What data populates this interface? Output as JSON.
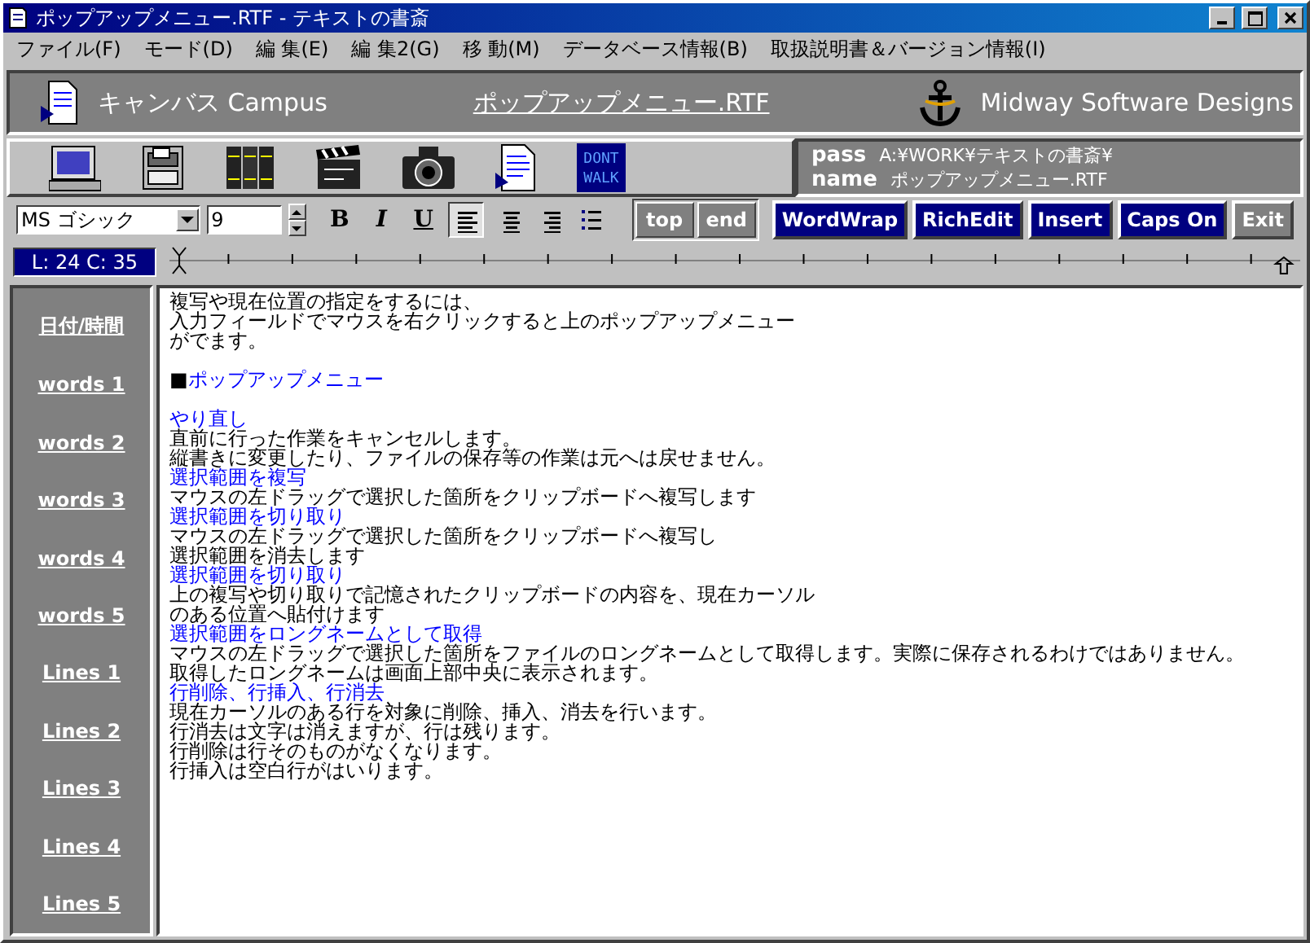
{
  "window": {
    "title": "ポップアップメニュー.RTF - テキストの書斎"
  },
  "menu": [
    "ファイル(F)",
    "モード(D)",
    "編 集(E)",
    "編 集2(G)",
    "移 動(M)",
    "データベース情報(B)",
    "取扱説明書＆バージョン情報(I)"
  ],
  "header": {
    "app_name": "キャンバス Campus",
    "document": "ポップアップメニュー.RTF",
    "company": "Midway Software Designs"
  },
  "toolbar": {
    "tools": [
      {
        "kind": "monitor"
      },
      {
        "kind": "cabinet"
      },
      {
        "kind": "books"
      },
      {
        "kind": "clapper"
      },
      {
        "kind": "camera"
      },
      {
        "kind": "document"
      },
      {
        "kind": "sign",
        "lines": [
          "DONT",
          "WALK"
        ]
      }
    ]
  },
  "info": {
    "pass_label": "pass",
    "pass": "A:¥WORK¥テキストの書斎¥",
    "name_label": "name",
    "name": "ポップアップメニュー.RTF"
  },
  "format": {
    "font": "MS ゴシック",
    "size": "9",
    "styles": [
      "B",
      "I",
      "U"
    ],
    "align": [
      {
        "kind": "left",
        "selected": true
      },
      {
        "kind": "center",
        "selected": false
      },
      {
        "kind": "right",
        "selected": false
      },
      {
        "kind": "bullets",
        "selected": false
      }
    ],
    "nav": [
      "top",
      "end"
    ],
    "actions": [
      {
        "label": "WordWrap",
        "kind": "mode"
      },
      {
        "label": "RichEdit",
        "kind": "mode"
      },
      {
        "label": "Insert",
        "kind": "mode"
      },
      {
        "label": "Caps On",
        "kind": "mode"
      },
      {
        "label": "Exit",
        "kind": "exit"
      }
    ]
  },
  "status": "L: 24 C: 35",
  "sidebar": {
    "items": [
      "日付/時間",
      "words 1",
      "words 2",
      "words 3",
      "words 4",
      "words 5",
      "Lines 1",
      "Lines 2",
      "Lines 3",
      "Lines 4",
      "Lines 5"
    ]
  },
  "editor": {
    "lines": [
      {
        "kind": "text",
        "text": "複写や現在位置の指定をするには、"
      },
      {
        "kind": "text",
        "text": "入力フィールドでマウスを右クリックすると上のポップアップメニュー"
      },
      {
        "kind": "text",
        "text": "がでます。"
      },
      {
        "kind": "blank"
      },
      {
        "kind": "heading",
        "marker": "■",
        "text": "ポップアップメニュー"
      },
      {
        "kind": "blank"
      },
      {
        "kind": "link",
        "text": "やり直し"
      },
      {
        "kind": "text",
        "text": "直前に行った作業をキャンセルします。"
      },
      {
        "kind": "text",
        "text": "縦書きに変更したり、ファイルの保存等の作業は元へは戻せません。"
      },
      {
        "kind": "link",
        "text": "選択範囲を複写"
      },
      {
        "kind": "text",
        "text": "マウスの左ドラッグで選択した箇所をクリップボードへ複写します"
      },
      {
        "kind": "link",
        "text": "選択範囲を切り取り"
      },
      {
        "kind": "text",
        "text": "マウスの左ドラッグで選択した箇所をクリップボードへ複写し"
      },
      {
        "kind": "text",
        "text": "選択範囲を消去します"
      },
      {
        "kind": "link",
        "text": "選択範囲を切り取り"
      },
      {
        "kind": "text",
        "text": "上の複写や切り取りで記憶されたクリップボードの内容を、現在カーソル"
      },
      {
        "kind": "text",
        "text": "のある位置へ貼付けます"
      },
      {
        "kind": "link",
        "text": "選択範囲をロングネームとして取得"
      },
      {
        "kind": "text",
        "text": "マウスの左ドラッグで選択した箇所をファイルのロングネームとして取得します。実際に保存されるわけではありません。"
      },
      {
        "kind": "text",
        "text": "取得したロングネームは画面上部中央に表示されます。"
      },
      {
        "kind": "link",
        "text": "行削除、行挿入、行消去"
      },
      {
        "kind": "text",
        "text": "現在カーソルのある行を対象に削除、挿入、消去を行います。"
      },
      {
        "kind": "text",
        "text": "行消去は文字は消えますが、行は残ります。"
      },
      {
        "kind": "text",
        "text": "行削除は行そのものがなくなります。"
      },
      {
        "kind": "text",
        "text": "行挿入は空白行がはいります。"
      }
    ]
  }
}
